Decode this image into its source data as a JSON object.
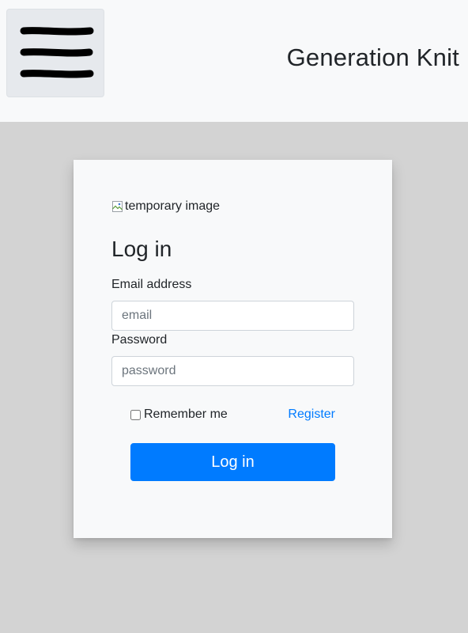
{
  "header": {
    "menu_icon": "hamburger-menu-icon",
    "app_title": "Generation Knit",
    "background": "#f8f9fa"
  },
  "login_card": {
    "image_alt": "temporary image",
    "heading": "Log in",
    "email": {
      "label": "Email address",
      "placeholder": "email",
      "value": ""
    },
    "password": {
      "label": "Password",
      "placeholder": "password",
      "value": ""
    },
    "remember_me": {
      "label": "Remember me",
      "checked": false
    },
    "register_link": "Register",
    "submit_label": "Log in"
  },
  "colors": {
    "page_background": "#d3d3d3",
    "card_background": "#f8f9fa",
    "primary": "#007bff",
    "text": "#212529"
  }
}
